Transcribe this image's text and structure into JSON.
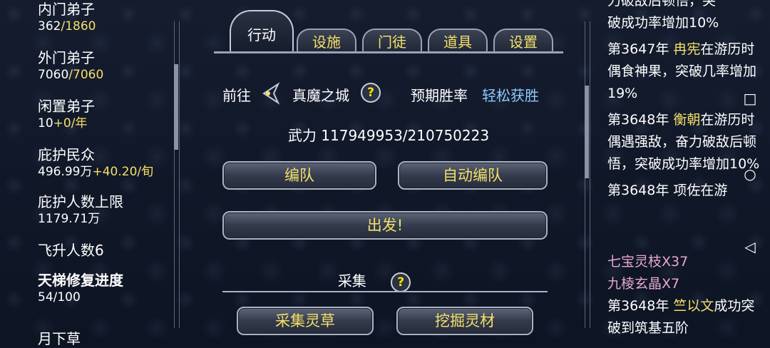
{
  "left": {
    "inner_disciples": {
      "label": "内门弟子",
      "current": "362",
      "separator": "/",
      "max": "1860"
    },
    "outer_disciples": {
      "label": "外门弟子",
      "current": "7060",
      "separator": "/",
      "max": "7060"
    },
    "idle_disciples": {
      "label": "闲置弟子",
      "value": "10",
      "rate": "+0/年"
    },
    "protected_people": {
      "label": "庇护民众",
      "value": "496.99万",
      "rate": "+40.20/旬"
    },
    "protect_limit": {
      "label": "庇护人数上限",
      "value": "1179.71万"
    },
    "ascension": {
      "label": "飞升人数6"
    },
    "ladder": {
      "label": "天梯修复进度",
      "value": "54/100"
    },
    "next_item": "月下草"
  },
  "tabs": [
    "行动",
    "设施",
    "门徒",
    "道具",
    "设置"
  ],
  "action": {
    "goto_label": "前往",
    "destination": "真魔之城",
    "help_glyph": "?",
    "win_rate_label": "预期胜率",
    "win_rate_value": "轻松获胜",
    "power_label": "武力",
    "power_value": "117949953/210750223",
    "formation_button": "编队",
    "auto_formation_button": "自动编队",
    "depart_button": "出发!",
    "gather_title": "采集",
    "gather_herb_button": "采集灵草",
    "mine_button": "挖掘灵材"
  },
  "log": {
    "partial_top": "力破敌后顿悟，突",
    "entry1_tail": "破成功率增加10%",
    "entry2": {
      "prefix": "第3647年 ",
      "name": "冉宪",
      "text": "在游历时偶食神果，突破几率增加19%"
    },
    "entry3": {
      "prefix": "第3648年 ",
      "name": "衡朝",
      "text": "在游历时偶遇强敌，奋力破敌后顿悟，突破成功率增加10%"
    },
    "entry4_cut": "第3648年  项佐在游",
    "reward1": "七宝灵枝X37",
    "reward2": "九棱玄晶X7",
    "entry5": {
      "prefix": "第3648年 ",
      "name": "竺以文",
      "text": "成功突破到筑基五阶"
    }
  },
  "nav": {
    "recents": "□",
    "home": "○",
    "back": "◁"
  },
  "colors": {
    "accent_yellow": "#f3e06a",
    "accent_blue": "#8ec9ff",
    "pink": "#e8a7cf",
    "background": "#0f1626"
  }
}
